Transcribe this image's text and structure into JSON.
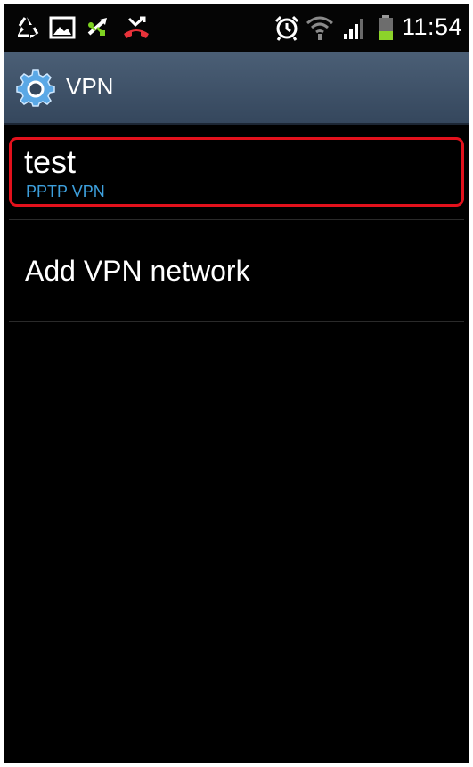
{
  "status_bar": {
    "time": "11:54",
    "icons": [
      "recycle-icon",
      "image-icon",
      "usb-icon",
      "missed-call-icon",
      "alarm-icon",
      "wifi-icon",
      "signal-icon",
      "battery-icon"
    ]
  },
  "action_bar": {
    "icon": "gear-icon",
    "title": "VPN"
  },
  "vpn_list": {
    "items": [
      {
        "name": "test",
        "type": "PPTP VPN"
      }
    ]
  },
  "add_vpn": {
    "label": "Add VPN network"
  },
  "colors": {
    "accent_blue": "#3d9fdc",
    "highlight_red": "#e3111c",
    "action_bar": "#415469"
  }
}
